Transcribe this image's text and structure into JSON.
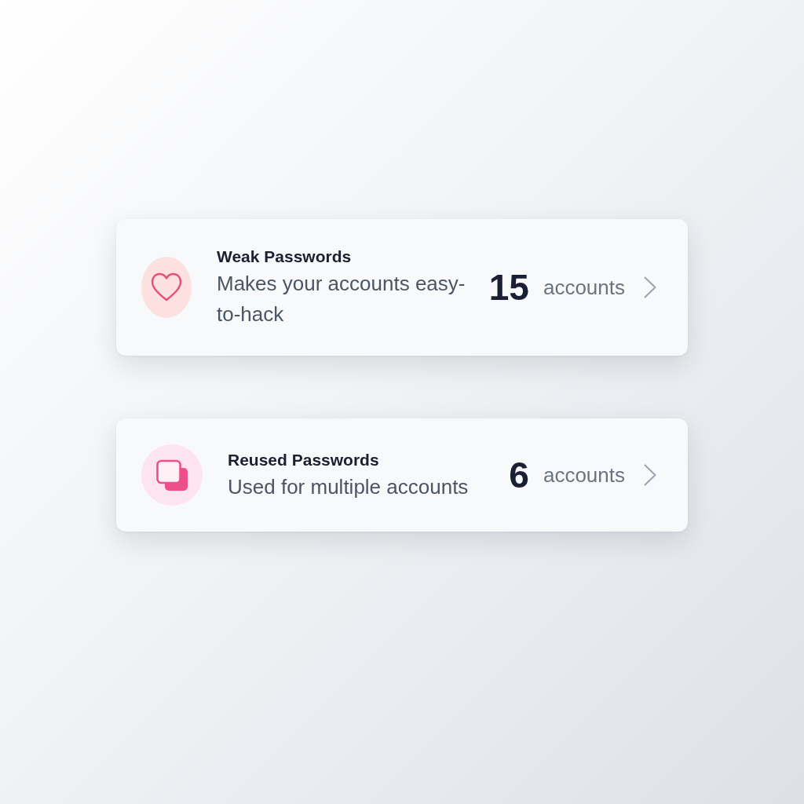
{
  "cards": [
    {
      "kind": "weak",
      "title": "Weak Passwords",
      "description": "Makes your accounts easy-to-hack",
      "count": "15",
      "unit": "accounts"
    },
    {
      "kind": "reused",
      "title": "Reused Passwords",
      "description": "Used for multiple accounts",
      "count": "6",
      "unit": "accounts"
    }
  ]
}
